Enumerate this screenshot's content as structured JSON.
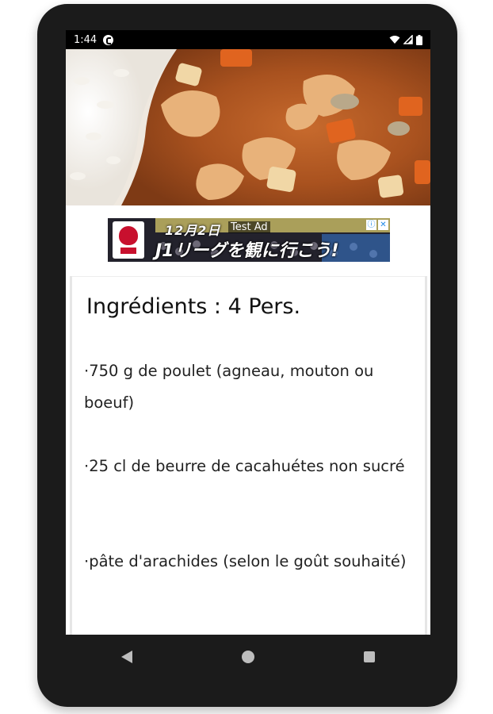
{
  "status_bar": {
    "time": "1:44"
  },
  "ad": {
    "top_text": "12月2日",
    "label": "Test Ad",
    "main_text": "J1リーグを観に行こう!",
    "choices_icon": "ⓘ",
    "close_icon": "✕"
  },
  "recipe": {
    "heading": "Ingrédients : 4 Pers.",
    "ingredients": [
      "·750 g de poulet (agneau, mouton ou boeuf)",
      "·25 cl de beurre de cacahuétes non sucré",
      "·pâte d'arachides (selon le goût souhaité)"
    ]
  },
  "colors": {
    "device": "#1b1b1b",
    "status_bar": "#000000",
    "nav_buttons": "#bdbdbd"
  }
}
